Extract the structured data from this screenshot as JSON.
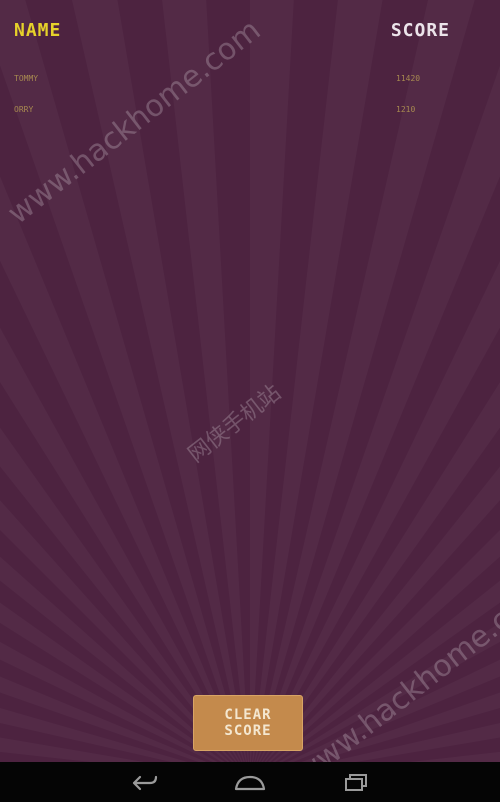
{
  "headers": {
    "name": "NAME",
    "score": "SCORE"
  },
  "scores": [
    {
      "name": "TOMMY",
      "score": "11420"
    },
    {
      "name": "ORRY",
      "score": "1210"
    }
  ],
  "clear_button": {
    "line1": "CLEAR",
    "line2": "SCORE"
  },
  "watermarks": {
    "top": "www.hackhome.com",
    "middle": "网侠手机站",
    "bottom": "www.hackhome.com"
  },
  "navbar": {
    "icons": [
      "back-icon",
      "home-icon",
      "recent-apps-icon"
    ]
  },
  "colors": {
    "background": "#4d2340",
    "name_header": "#e6d22a",
    "score_header": "#ece4ea",
    "row_text": "#b69a52",
    "button": "#c48a4c",
    "navbar": "#050505"
  }
}
